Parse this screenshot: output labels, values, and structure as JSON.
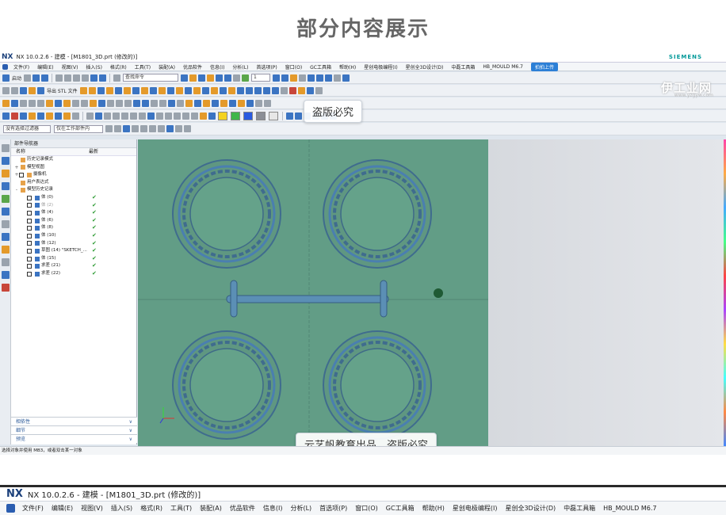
{
  "heading": "部分内容展示",
  "window_title": "NX 10.0.2.6 - 建模 - [M1801_3D.prt (修改的)]",
  "nx_logo": "NX",
  "brand": "SIEMENS",
  "menu": [
    "文件(F)",
    "编辑(E)",
    "视图(V)",
    "插入(S)",
    "格式(R)",
    "工具(T)",
    "装配(A)",
    "优品软件",
    "信息(I)",
    "分析(L)",
    "首选项(P)",
    "窗口(O)",
    "GC工具箱",
    "帮助(H)",
    "星创电极编程(I)",
    "星创全3D设计(D)",
    "中磊工具箱",
    "HB_MOULD M6.7"
  ],
  "login_button": "拍拍上传",
  "toolbar": {
    "start": "启动",
    "search_placeholder": "查找命令",
    "stl_label": "导出 STL 文件",
    "filter_select": "没有选择过滤器",
    "scope_select": "仅在工作部件内",
    "layer_value": "1"
  },
  "navigator": {
    "title": "部件导航器",
    "col_name": "名称",
    "col_latest": "最新",
    "items": [
      {
        "label": "历史记录模式",
        "ok": false,
        "grey": false,
        "pm": "",
        "chk": false
      },
      {
        "label": "模型视图",
        "ok": false,
        "grey": false,
        "pm": "+",
        "chk": false
      },
      {
        "label": "摄像机",
        "ok": false,
        "grey": false,
        "pm": "+",
        "chk": true
      },
      {
        "label": "用户表达式",
        "ok": false,
        "grey": false,
        "pm": "",
        "chk": false
      },
      {
        "label": "模型历史记录",
        "ok": false,
        "grey": false,
        "pm": "-",
        "chk": false
      },
      {
        "label": "体 (0)",
        "ok": true,
        "grey": false,
        "pm": "",
        "chk": true
      },
      {
        "label": "体 (2)",
        "ok": true,
        "grey": true,
        "pm": "",
        "chk": true
      },
      {
        "label": "体 (4)",
        "ok": true,
        "grey": false,
        "pm": "",
        "chk": true
      },
      {
        "label": "体 (6)",
        "ok": true,
        "grey": false,
        "pm": "",
        "chk": true
      },
      {
        "label": "体 (8)",
        "ok": true,
        "grey": false,
        "pm": "",
        "chk": true
      },
      {
        "label": "体 (10)",
        "ok": true,
        "grey": false,
        "pm": "",
        "chk": true
      },
      {
        "label": "体 (12)",
        "ok": true,
        "grey": false,
        "pm": "",
        "chk": true
      },
      {
        "label": "草图 (14) \"SKETCH_...",
        "ok": true,
        "grey": false,
        "pm": "",
        "chk": true
      },
      {
        "label": "体 (15)",
        "ok": true,
        "grey": false,
        "pm": "",
        "chk": true
      },
      {
        "label": "求差 (21)",
        "ok": true,
        "grey": false,
        "pm": "",
        "chk": true
      },
      {
        "label": "求差 (22)",
        "ok": true,
        "grey": false,
        "pm": "",
        "chk": true
      }
    ],
    "sections": [
      "相依性",
      "细节",
      "预览"
    ]
  },
  "status_text": "选择对象并使用 MB3，或者双击某一对象",
  "watermark_top": "盗版必究",
  "watermark_bottom": "云艺帆教育出品　盗版必究",
  "site_logo": "伊工业网",
  "site_url": "www.yzgyw.com",
  "colors": [
    "#f4d21f",
    "#3fb64a",
    "#2a5be0",
    "#8b8f96",
    "#e7e7e7"
  ]
}
